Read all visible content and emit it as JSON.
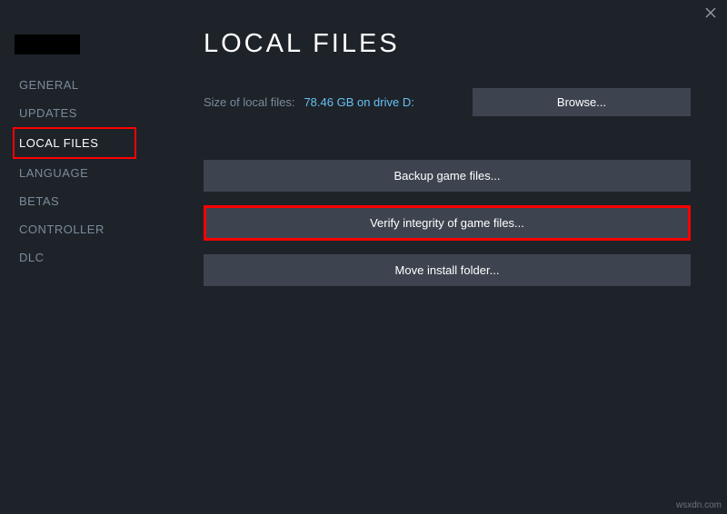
{
  "close_label": "×",
  "sidebar": {
    "items": [
      {
        "label": "GENERAL",
        "active": false
      },
      {
        "label": "UPDATES",
        "active": false
      },
      {
        "label": "LOCAL FILES",
        "active": true
      },
      {
        "label": "LANGUAGE",
        "active": false
      },
      {
        "label": "BETAS",
        "active": false
      },
      {
        "label": "CONTROLLER",
        "active": false
      },
      {
        "label": "DLC",
        "active": false
      }
    ]
  },
  "main": {
    "title": "LOCAL FILES",
    "size_label": "Size of local files:",
    "size_value": "78.46 GB on drive D:",
    "browse_label": "Browse...",
    "backup_label": "Backup game files...",
    "verify_label": "Verify integrity of game files...",
    "move_label": "Move install folder..."
  },
  "watermark": "wsxdn.com"
}
